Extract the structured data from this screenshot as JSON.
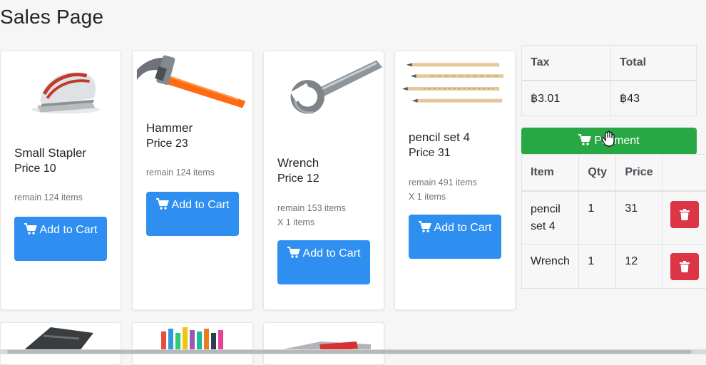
{
  "page": {
    "title": "Sales Page"
  },
  "colors": {
    "primary": "#2f8ff0",
    "success": "#28a745",
    "danger": "#dc3545"
  },
  "products": [
    {
      "name": "Small Stapler",
      "price": "Price 10",
      "remain": "remain 124 items",
      "qty": "",
      "button": "Add to Cart",
      "icon": "stapler-image"
    },
    {
      "name": "Hammer",
      "price": "Price 23",
      "remain": "remain 124 items",
      "qty": "",
      "button": "Add to Cart",
      "icon": "hammer-image"
    },
    {
      "name": "Wrench",
      "price": "Price 12",
      "remain": "remain 153 items",
      "qty": "X 1 items",
      "button": "Add to Cart",
      "icon": "wrench-image"
    },
    {
      "name": "pencil set 4",
      "price": "Price 31",
      "remain": "remain 491 items",
      "qty": "X 1 items",
      "button": "Add to Cart",
      "icon": "pencil-set-image"
    }
  ],
  "more_products": [
    {
      "icon": "calculator-image"
    },
    {
      "icon": "markers-image"
    },
    {
      "icon": "multitool-image"
    }
  ],
  "summary": {
    "headers": [
      "Tax",
      "Total"
    ],
    "tax": "฿3.01",
    "total": "฿43"
  },
  "payment_button": "Payment",
  "cart": {
    "headers": [
      "Item",
      "Qty",
      "Price",
      ""
    ],
    "rows": [
      {
        "item": "pencil set 4",
        "qty": "1",
        "price": "31"
      },
      {
        "item": "Wrench",
        "qty": "1",
        "price": "12"
      }
    ]
  }
}
